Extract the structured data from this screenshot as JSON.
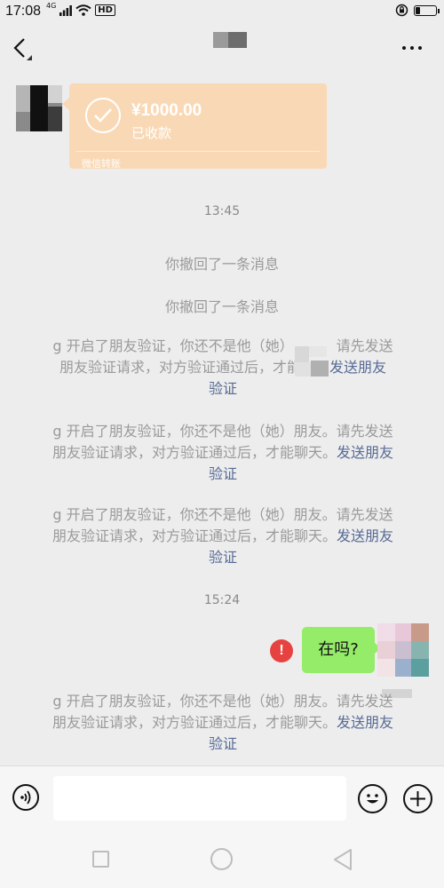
{
  "status_bar": {
    "time": "17:08",
    "network": "4G",
    "hd": "HD"
  },
  "transfer": {
    "amount": "¥1000.00",
    "status": "已收款",
    "label": "微信转账"
  },
  "messages": {
    "time_1": "13:45",
    "recall_1": "你撤回了一条消息",
    "recall_2": "你撤回了一条消息",
    "verify_1": {
      "line1": "g 开启了朋友验证，你还不是他（她）",
      "line1_end": "，请先发送",
      "line2": "朋友验证请求，对方验证通过后，才能",
      "link_a": "发送朋友",
      "link_b": "验证"
    },
    "verify_2": {
      "line1": "g 开启了朋友验证，你还不是他（她）朋友。请先发送",
      "line2": "朋友验证请求，对方验证通过后，才能聊天。",
      "link_a": "发送朋友",
      "link_b": "验证"
    },
    "verify_3": {
      "line1": "g 开启了朋友验证，你还不是他（她）朋友。请先发送",
      "line2": "朋友验证请求，对方验证通过后，才能聊天。",
      "link_a": "发送朋友",
      "link_b": "验证"
    },
    "time_2": "15:24",
    "sent_text": "在吗?",
    "verify_4": {
      "line1": "g 开启了朋友验证，你还不是他（她）朋友。请先发送",
      "line2": "朋友验证请求，对方验证通过后，才能聊天。",
      "link_a": "发送朋友",
      "link_b": "验证"
    }
  },
  "colors": {
    "transfer_bg": "#f9d9b5",
    "bubble_green": "#95ec69",
    "link_blue": "#576b95",
    "error_red": "#e64340"
  },
  "icons": {
    "back": "back-arrow-icon",
    "more": "more-dots-icon",
    "voice": "voice-icon",
    "emoji": "emoji-icon",
    "plus": "plus-icon"
  },
  "battery_level": 0.2
}
